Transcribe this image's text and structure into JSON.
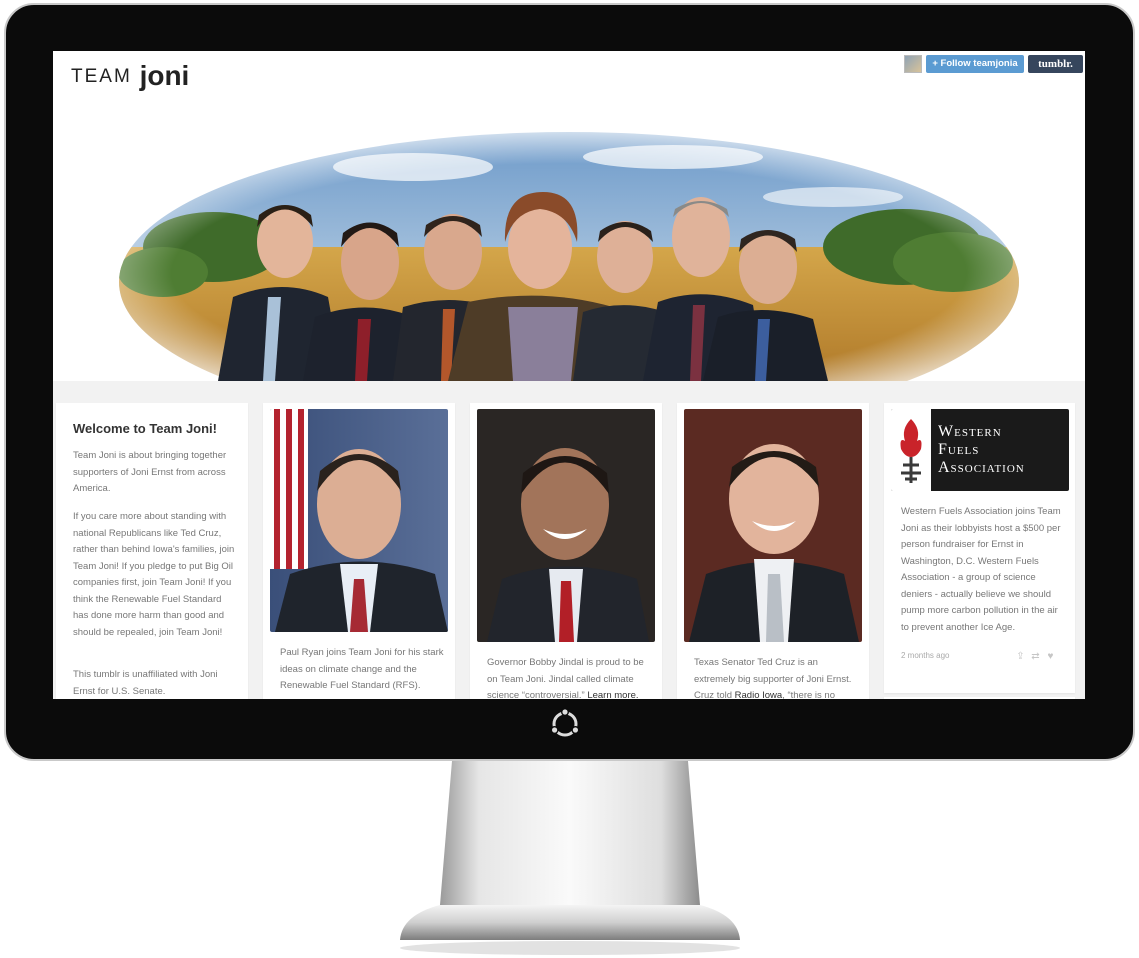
{
  "header": {
    "logo_team": "TEAM",
    "logo_joni": "joni",
    "follow_label": "+ Follow teamjonia",
    "tumblr_label": "tumblr."
  },
  "welcome": {
    "title": "Welcome to Team Joni!",
    "paragraphs": [
      "Team Joni is about bringing together supporters of Joni Ernst from across America.",
      "If you care more about standing with national Republicans like Ted Cruz, rather than behind Iowa's families, join Team Joni! If you pledge to put Big Oil companies first, join Team Joni! If you think the Renewable Fuel Standard has done more harm than good and should be repealed, join Team Joni!",
      "This tumblr is unaffiliated with Joni Ernst for U.S. Senate."
    ]
  },
  "posts": [
    {
      "caption": "Paul Ryan joins Team Joni for his stark ideas on climate change and the Renewable Fuel Standard (RFS)."
    },
    {
      "caption_start": "Governor Bobby Jindal is proud to be on Team Joni. Jindal called climate science “controversial.”",
      "link": "Learn more."
    },
    {
      "caption_start": "Texas Senator Ted Cruz is an extremely big supporter of Joni Ernst. Cruz told",
      "link": "Radio Iowa",
      "caption_end": ", “there is no"
    },
    {
      "logo_line1": "Western",
      "logo_line2": "Fuels",
      "logo_line3": "Association",
      "caption": "Western Fuels Association joins Team Joni as their lobbyists host a $500 per person fundraiser for Ernst in Washington, D.C. Western Fuels Association - a group of science deniers - actually believe we should pump more carbon pollution in the air to prevent another Ice Age.",
      "timestamp": "2 months ago"
    }
  ],
  "post_icons": [
    "share-icon",
    "reblog-icon",
    "like-icon"
  ],
  "colors": {
    "follow": "#5b9bd2",
    "tumblr": "#36465d",
    "background": "#f2f2f2"
  }
}
